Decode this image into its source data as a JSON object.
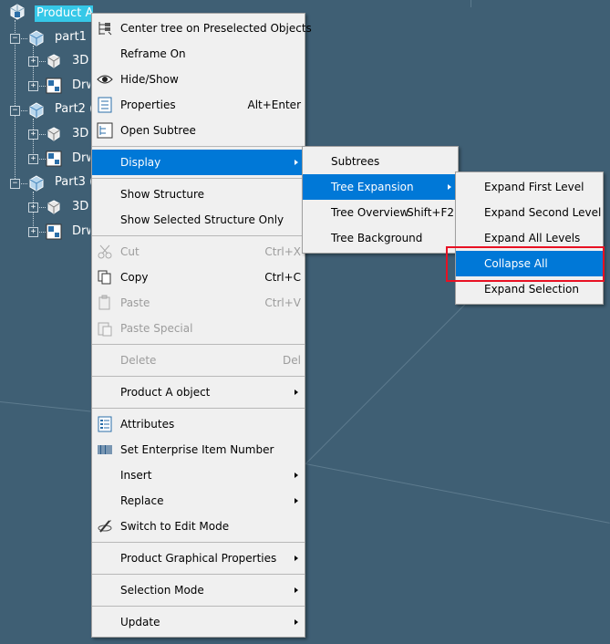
{
  "tree": {
    "root": "Product A",
    "nodes": [
      {
        "label": "part1 (",
        "children": [
          "3D",
          "Drw"
        ]
      },
      {
        "label": "Part2 (",
        "children": [
          "3D",
          "Drw"
        ]
      },
      {
        "label": "Part3 (",
        "children": [
          "3D",
          "Drw"
        ]
      }
    ]
  },
  "context_menu": {
    "items": [
      {
        "label": "Center tree on Preselected Objects",
        "icon": "center-tree-icon"
      },
      {
        "label": "Reframe On"
      },
      {
        "label": "Hide/Show",
        "icon": "eye-icon"
      },
      {
        "label": "Properties",
        "shortcut": "Alt+Enter",
        "icon": "properties-icon"
      },
      {
        "label": "Open Subtree",
        "icon": "subtree-icon"
      },
      {
        "label": "Display",
        "submenu": true
      },
      {
        "label": "Show Structure"
      },
      {
        "label": "Show Selected Structure Only"
      },
      {
        "label": "Cut",
        "shortcut": "Ctrl+X",
        "disabled": true,
        "icon": "scissors-icon"
      },
      {
        "label": "Copy",
        "shortcut": "Ctrl+C",
        "icon": "copy-icon"
      },
      {
        "label": "Paste",
        "shortcut": "Ctrl+V",
        "disabled": true,
        "icon": "paste-icon"
      },
      {
        "label": "Paste Special",
        "disabled": true,
        "icon": "paste-special-icon"
      },
      {
        "label": "Delete",
        "shortcut": "Del",
        "disabled": true
      },
      {
        "label": "Product A object",
        "submenu": true
      },
      {
        "label": "Attributes",
        "icon": "attributes-icon"
      },
      {
        "label": "Set Enterprise Item Number",
        "icon": "barcode-icon"
      },
      {
        "label": "Insert",
        "submenu": true
      },
      {
        "label": "Replace",
        "submenu": true
      },
      {
        "label": "Switch to Edit Mode",
        "icon": "edit-mode-icon"
      },
      {
        "label": "Product Graphical Properties",
        "submenu": true
      },
      {
        "label": "Selection Mode",
        "submenu": true
      },
      {
        "label": "Update",
        "submenu": true
      }
    ]
  },
  "display_menu": {
    "items": [
      {
        "label": "Subtrees"
      },
      {
        "label": "Tree Expansion",
        "submenu": true
      },
      {
        "label": "Tree Overview",
        "shortcut": "Shift+F2"
      },
      {
        "label": "Tree Background"
      }
    ]
  },
  "expansion_menu": {
    "items": [
      {
        "label": "Expand First Level"
      },
      {
        "label": "Expand Second Level"
      },
      {
        "label": "Expand All Levels"
      },
      {
        "label": "Collapse All"
      },
      {
        "label": "Expand Selection"
      }
    ]
  },
  "colors": {
    "background": "#3f5f74",
    "highlight": "#0078d7",
    "annotation_box": "#e81123"
  }
}
